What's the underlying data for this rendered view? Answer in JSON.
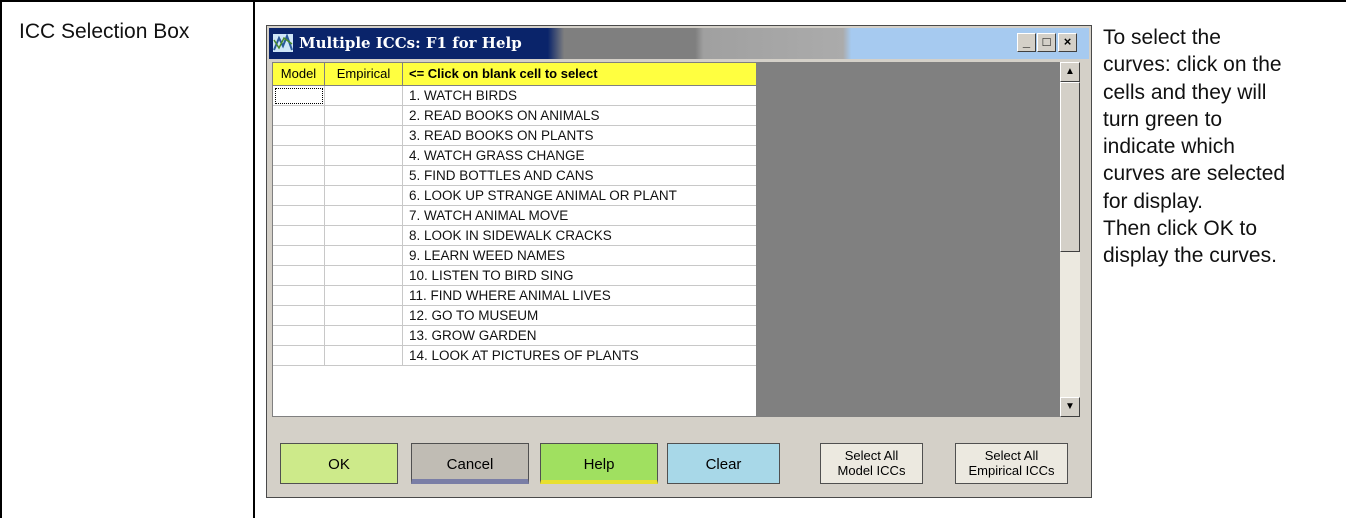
{
  "row_label": "ICC Selection Box",
  "help_lines": [
    "To select the",
    "curves: click on the",
    "cells and they will",
    "turn green to",
    "indicate which",
    "curves are selected",
    "for display.",
    "Then click OK to",
    "display the curves."
  ],
  "window": {
    "title": "Multiple ICCs: F1 for Help",
    "minimize": "_",
    "maximize": "□",
    "close": "×"
  },
  "grid": {
    "headers": [
      "Model",
      "Empirical",
      "<= Click on blank cell to select"
    ],
    "items": [
      "1. WATCH BIRDS",
      "2. READ BOOKS ON ANIMALS",
      "3. READ BOOKS ON PLANTS",
      "4. WATCH GRASS CHANGE",
      "5. FIND BOTTLES AND CANS",
      "6. LOOK UP STRANGE ANIMAL OR PLANT",
      "7. WATCH ANIMAL MOVE",
      "8. LOOK IN SIDEWALK CRACKS",
      "9. LEARN WEED NAMES",
      "10. LISTEN TO BIRD SING",
      "11. FIND WHERE ANIMAL LIVES",
      "12. GO TO MUSEUM",
      "13. GROW GARDEN",
      "14. LOOK AT PICTURES OF PLANTS"
    ]
  },
  "buttons": {
    "ok": "OK",
    "cancel": "Cancel",
    "help": "Help",
    "clear": "Clear",
    "select_model_1": "Select All",
    "select_model_2": "Model ICCs",
    "select_emp_1": "Select All",
    "select_emp_2": "Empirical ICCs"
  },
  "colors": {
    "ok": "#cdea8a",
    "cancel": "#c0bcb4",
    "help": "#a0e060",
    "clear": "#a8d8e8",
    "header": "#ffff40"
  }
}
